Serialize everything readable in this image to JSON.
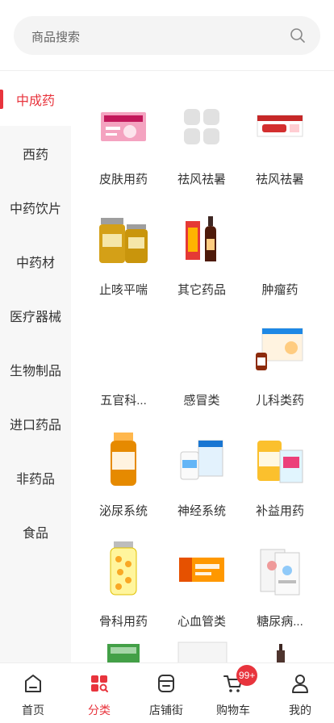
{
  "search": {
    "placeholder": "商品搜索",
    "icon": "search-icon"
  },
  "sidebar": {
    "active_color": "#e8343d",
    "items": [
      {
        "label": "中成药",
        "active": true
      },
      {
        "label": "西药"
      },
      {
        "label": "中药饮片"
      },
      {
        "label": "中药材"
      },
      {
        "label": "医疗器械"
      },
      {
        "label": "生物制品"
      },
      {
        "label": "进口药品"
      },
      {
        "label": "非药品"
      },
      {
        "label": "食品"
      }
    ]
  },
  "products": [
    {
      "name": "皮肤用药",
      "icon": "skin-medicine-box-icon"
    },
    {
      "name": "祛风祛暑",
      "icon": "placeholder-image-icon"
    },
    {
      "name": "祛风祛暑",
      "icon": "medicine-box-icon"
    },
    {
      "name": "止咳平喘",
      "icon": "honey-jar-icon"
    },
    {
      "name": "其它药品",
      "icon": "bottle-and-box-icon"
    },
    {
      "name": "肿瘤药",
      "icon": "blank-image-icon"
    },
    {
      "name": "五官科...",
      "icon": "blank-image-icon"
    },
    {
      "name": "感冒类",
      "icon": "blank-image-icon"
    },
    {
      "name": "儿科类药",
      "icon": "pediatric-medicine-icon"
    },
    {
      "name": "泌尿系统",
      "icon": "supplement-bottle-icon"
    },
    {
      "name": "神经系统",
      "icon": "pill-bottles-icon"
    },
    {
      "name": "补益用药",
      "icon": "tonic-cans-icon"
    },
    {
      "name": "骨科用药",
      "icon": "softgel-bottle-icon"
    },
    {
      "name": "心血管类",
      "icon": "orange-box-icon"
    },
    {
      "name": "糖尿病...",
      "icon": "test-strip-packs-icon"
    }
  ],
  "tabbar": {
    "items": [
      {
        "label": "首页",
        "icon": "home-icon"
      },
      {
        "label": "分类",
        "icon": "category-icon",
        "active": true
      },
      {
        "label": "店铺街",
        "icon": "store-icon"
      },
      {
        "label": "购物车",
        "icon": "cart-icon",
        "badge": "99+"
      },
      {
        "label": "我的",
        "icon": "user-icon"
      }
    ]
  }
}
